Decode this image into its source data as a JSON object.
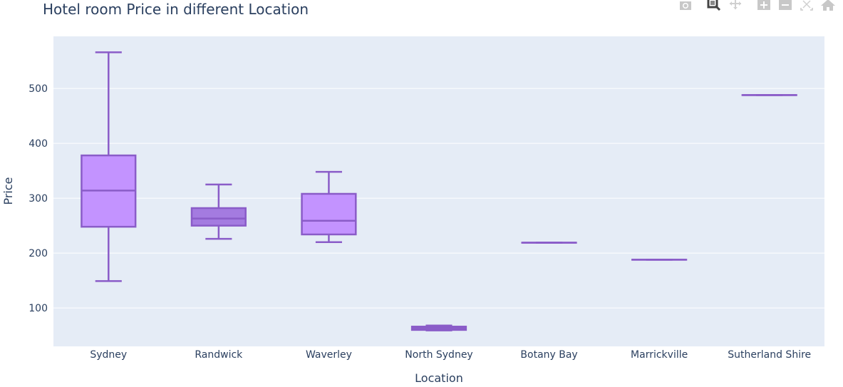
{
  "modebar": {
    "buttons": [
      {
        "name": "camera-icon",
        "title": "Download plot as a png"
      },
      {
        "name": "zoom-icon",
        "title": "Zoom"
      },
      {
        "name": "pan-icon",
        "title": "Pan"
      },
      {
        "name": "zoom-in-icon",
        "title": "Zoom in"
      },
      {
        "name": "zoom-out-icon",
        "title": "Zoom out"
      },
      {
        "name": "autoscale-icon",
        "title": "Autoscale"
      },
      {
        "name": "home-icon",
        "title": "Reset axes"
      }
    ]
  },
  "colors": {
    "plot_bg": "#E5ECF6",
    "grid": "#ffffff",
    "box_line": "#8A5CC8",
    "box_fill": "#C393FF",
    "box_fill_dark": "#A47BE0",
    "text": "#2a3f5f",
    "modebar_icon": "#c8c8c8"
  },
  "chart_data": {
    "type": "box",
    "title": "Hotel room Price in different Location",
    "xlabel": "Location",
    "ylabel": "Price",
    "ylim": [
      30,
      595
    ],
    "yticks": [
      100,
      200,
      300,
      400,
      500
    ],
    "grid": true,
    "legend": "none",
    "categories": [
      "Sydney",
      "Randwick",
      "Waverley",
      "North Sydney",
      "Botany Bay",
      "Marrickville",
      "Sutherland Shire"
    ],
    "boxes": [
      {
        "name": "Sydney",
        "min": 149,
        "q1": 248,
        "median": 314,
        "q3": 378,
        "max": 566
      },
      {
        "name": "Randwick",
        "min": 226,
        "q1": 250,
        "median": 263,
        "q3": 282,
        "max": 325
      },
      {
        "name": "Waverley",
        "min": 220,
        "q1": 234,
        "median": 259,
        "q3": 308,
        "max": 348
      },
      {
        "name": "North Sydney",
        "min": 59,
        "q1": 60,
        "median": 63,
        "q3": 66,
        "max": 68
      },
      {
        "name": "Botany Bay",
        "min": 219,
        "q1": 219,
        "median": 219,
        "q3": 219,
        "max": 219
      },
      {
        "name": "Marrickville",
        "min": 188,
        "q1": 188,
        "median": 188,
        "q3": 188,
        "max": 188
      },
      {
        "name": "Sutherland Shire",
        "min": 488,
        "q1": 488,
        "median": 488,
        "q3": 488,
        "max": 488
      }
    ]
  }
}
